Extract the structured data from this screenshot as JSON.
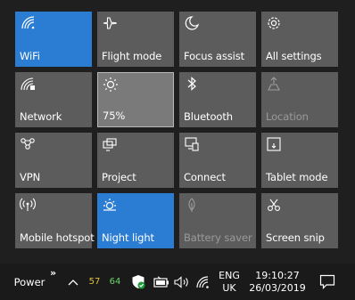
{
  "quick_actions": [
    {
      "label": "WiFi",
      "icon": "wifi-icon",
      "state": "on"
    },
    {
      "label": "Flight mode",
      "icon": "airplane-icon",
      "state": "off"
    },
    {
      "label": "Focus assist",
      "icon": "moon-icon",
      "state": "off"
    },
    {
      "label": "All settings",
      "icon": "gear-icon",
      "state": "off"
    },
    {
      "label": "Network",
      "icon": "network-icon",
      "state": "off"
    },
    {
      "label": "75%",
      "icon": "brightness-icon",
      "state": "selected"
    },
    {
      "label": "Bluetooth",
      "icon": "bluetooth-icon",
      "state": "off"
    },
    {
      "label": "Location",
      "icon": "location-icon",
      "state": "disabled"
    },
    {
      "label": "VPN",
      "icon": "vpn-icon",
      "state": "off"
    },
    {
      "label": "Project",
      "icon": "project-icon",
      "state": "off"
    },
    {
      "label": "Connect",
      "icon": "connect-icon",
      "state": "off"
    },
    {
      "label": "Tablet mode",
      "icon": "tablet-mode-icon",
      "state": "off"
    },
    {
      "label": "Mobile hotspot",
      "icon": "hotspot-icon",
      "state": "off"
    },
    {
      "label": "Night light",
      "icon": "night-light-icon",
      "state": "on"
    },
    {
      "label": "Battery saver",
      "icon": "battery-saver-icon",
      "state": "disabled"
    },
    {
      "label": "Screen snip",
      "icon": "screen-snip-icon",
      "state": "off"
    }
  ],
  "colors": {
    "tile_on": "#2b7cd3",
    "tile_off": "#5c5c5c",
    "background": "#1f1f1f",
    "cpu_text": "#e0c23a",
    "gpu_text": "#6cd36c"
  },
  "taskbar": {
    "power_label": "Power",
    "chevron": "»",
    "cpu_value": "57",
    "gpu_value": "64",
    "language_line1": "ENG",
    "language_line2": "UK",
    "time": "19:10:27",
    "date": "26/03/2019"
  }
}
